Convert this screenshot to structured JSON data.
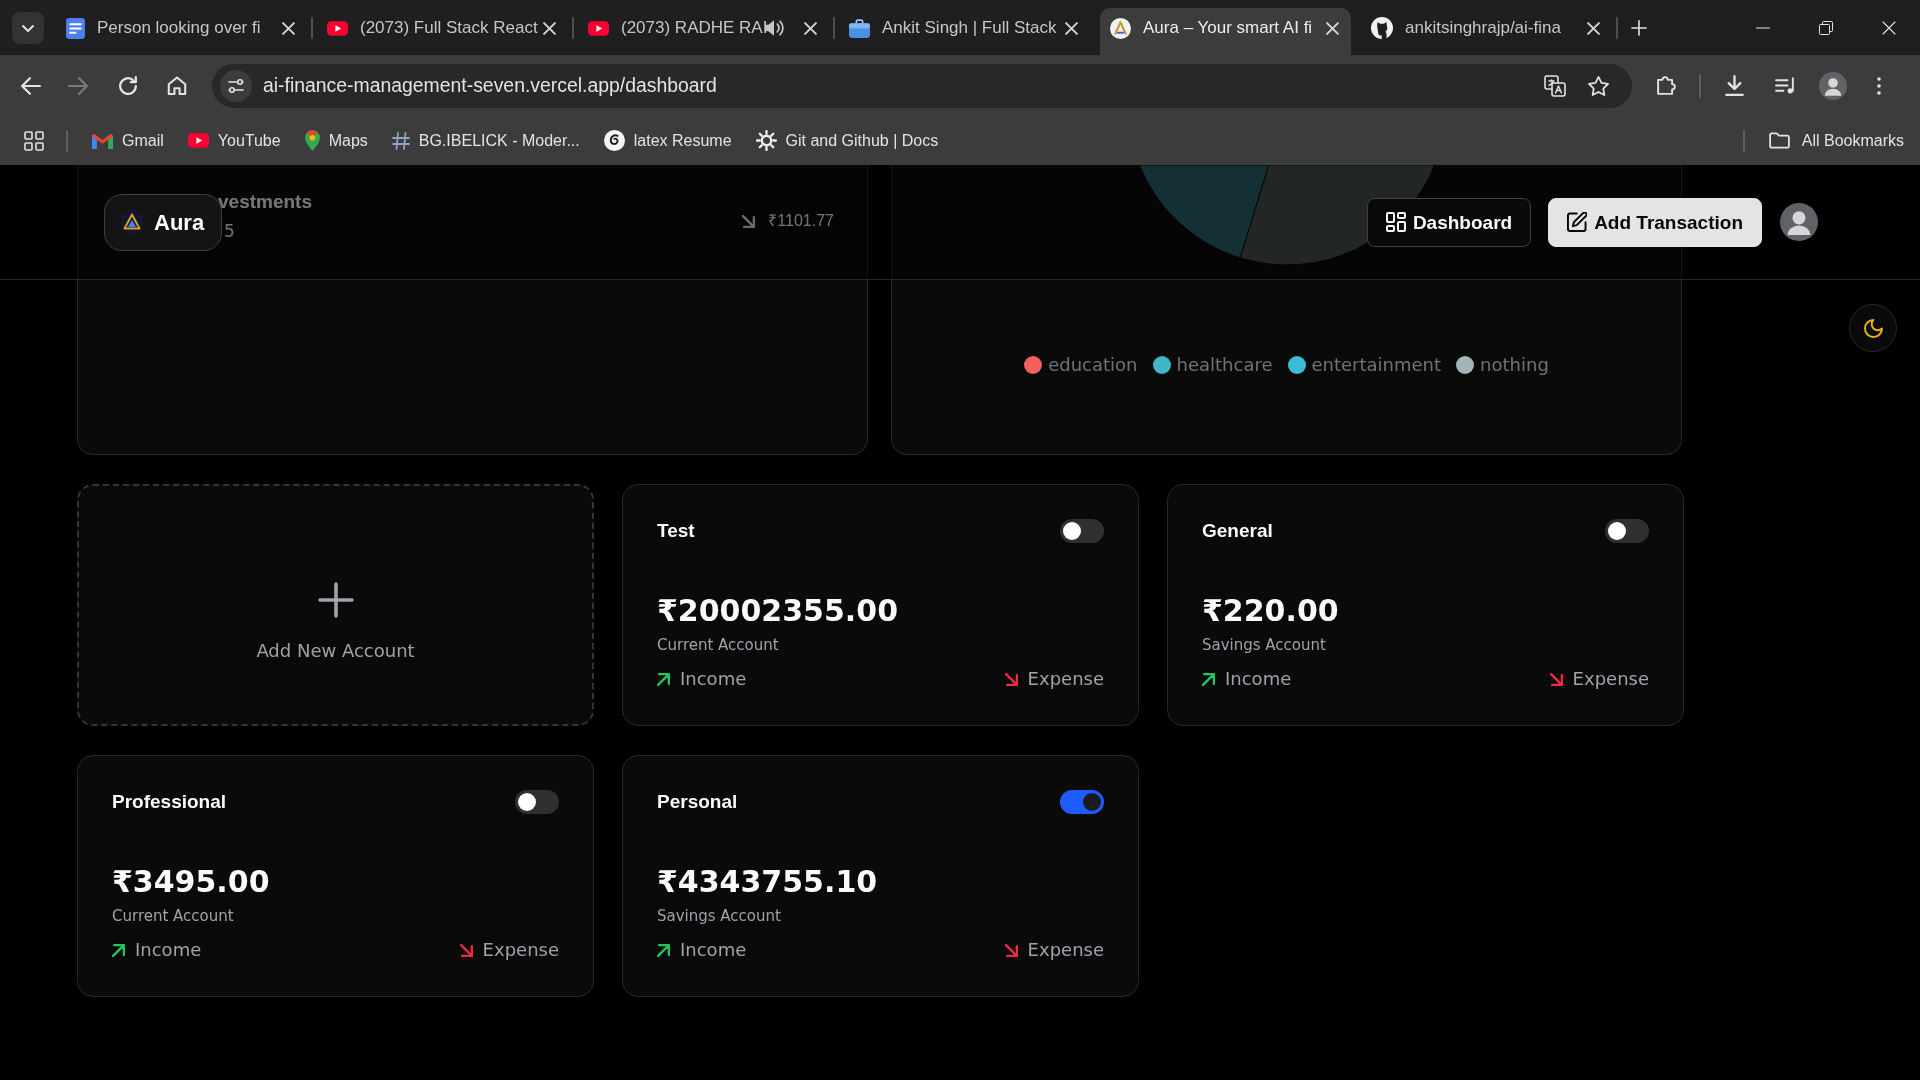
{
  "browser": {
    "tabs": [
      {
        "title": "Person looking over fi",
        "kind": "document",
        "audio": false,
        "selected": false
      },
      {
        "title": "(2073) Full Stack React",
        "kind": "video",
        "audio": false,
        "selected": false
      },
      {
        "title": "(2073) RADHE RAI",
        "kind": "video",
        "audio": true,
        "selected": false
      },
      {
        "title": "Ankit Singh | Full Stack",
        "kind": "briefcase",
        "audio": false,
        "selected": false
      },
      {
        "title": "Aura – Your smart AI fi",
        "kind": "logo",
        "audio": false,
        "selected": true
      },
      {
        "title": "ankitsinghrajp/ai-fina",
        "kind": "cat",
        "audio": false,
        "selected": false
      }
    ],
    "forward": {
      "disabled": true
    },
    "address_bar": {
      "url": "ai-finance-management-seven.vercel.app/dashboard"
    },
    "bookmarks": [
      {
        "label": "Gmail",
        "kind": "mail"
      },
      {
        "label": "YouTube",
        "kind": "video"
      },
      {
        "label": "Maps",
        "kind": "pin"
      },
      {
        "label": "BG.IBELICK - Moder...",
        "kind": "hash"
      },
      {
        "label": "latex Resume",
        "kind": "swirl"
      },
      {
        "label": "Git and Github | Docs",
        "kind": "gear"
      }
    ],
    "all_bookmarks": "All Bookmarks"
  },
  "header": {
    "brand": "Aura",
    "buttons": [
      {
        "label": "Dashboard",
        "kind": "outline"
      },
      {
        "label": "Add Transaction",
        "kind": "solid"
      }
    ]
  },
  "transactions_card": {
    "rows": [
      {
        "description": "vestments",
        "date": "5",
        "kind": "expense",
        "amount": "₹1101.77"
      }
    ]
  },
  "pie_card": {
    "legend": [
      {
        "label": "education",
        "color": "#f25f5c"
      },
      {
        "label": "healthcare",
        "color": "#3eb6c8"
      },
      {
        "label": "entertainment",
        "color": "#38bfd6"
      },
      {
        "label": "nothing",
        "color": "#a3b5b7"
      }
    ]
  },
  "accounts": {
    "add_label": "Add New Account",
    "items": [
      {
        "name": "Test",
        "on": false,
        "balance": "₹20002355.00",
        "type": "Current Account",
        "income_label": "Income",
        "expense_label": "Expense"
      },
      {
        "name": "General",
        "on": false,
        "balance": "₹220.00",
        "type": "Savings Account",
        "income_label": "Income",
        "expense_label": "Expense"
      },
      {
        "name": "Professional",
        "on": false,
        "balance": "₹3495.00",
        "type": "Current Account",
        "income_label": "Income",
        "expense_label": "Expense"
      },
      {
        "name": "Personal",
        "on": true,
        "balance": "₹4343755.10",
        "type": "Savings Account",
        "income_label": "Income",
        "expense_label": "Expense"
      }
    ]
  }
}
